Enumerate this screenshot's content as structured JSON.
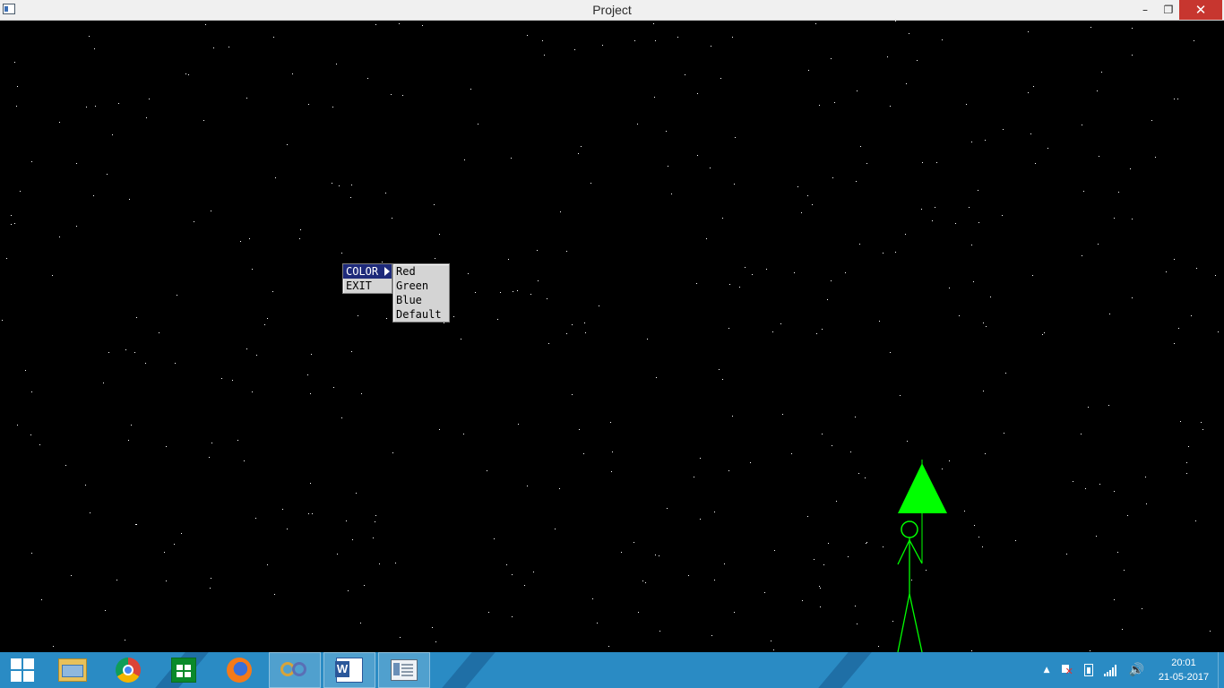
{
  "window": {
    "title": "Project",
    "minimize_symbol": "–",
    "maximize_symbol": "❐",
    "close_symbol": "✕"
  },
  "context_menu": {
    "items": [
      {
        "label": "COLOR",
        "selected": true,
        "has_submenu": true
      },
      {
        "label": "EXIT",
        "selected": false
      }
    ],
    "submenu": {
      "items": [
        {
          "label": "Red"
        },
        {
          "label": "Green"
        },
        {
          "label": "Blue"
        },
        {
          "label": "Default"
        }
      ]
    }
  },
  "scene": {
    "background_color": "#000000",
    "star_color": "#ffffff",
    "figure_color": "#00ff00"
  },
  "taskbar": {
    "color": "#2a8bc4",
    "apps": [
      {
        "name": "file-explorer-icon"
      },
      {
        "name": "chrome-icon"
      },
      {
        "name": "store-icon"
      },
      {
        "name": "firefox-icon"
      },
      {
        "name": "visual-studio-icon"
      },
      {
        "name": "word-icon"
      },
      {
        "name": "project-window-icon",
        "active": true
      }
    ],
    "tray": {
      "up_arrow": "▲",
      "volume_symbol": "🔊",
      "time": "20:01",
      "date": "21-05-2017"
    }
  }
}
